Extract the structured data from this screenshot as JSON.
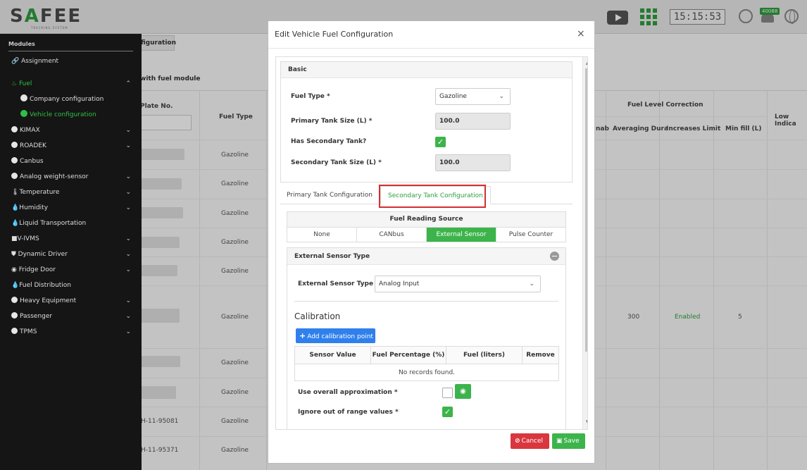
{
  "header": {
    "logo_text": "SAFEE",
    "logo_subtitle": "TRACKING SYSTEM",
    "clock": "15:15:53",
    "notification_count": "40088"
  },
  "sidebar": {
    "title": "Modules",
    "items": [
      {
        "label": "Assignment",
        "icon": "link-icon"
      },
      {
        "label": "Fuel",
        "icon": "fuel-icon",
        "chevron": "^"
      },
      {
        "label": "Company configuration"
      },
      {
        "label": "Vehicle configuration"
      },
      {
        "label": "KIMAX",
        "chevron": "v"
      },
      {
        "label": "ROADEK",
        "chevron": "v"
      },
      {
        "label": "Canbus"
      },
      {
        "label": "Analog weight-sensor",
        "chevron": "v"
      },
      {
        "label": "Temperature",
        "chevron": "v"
      },
      {
        "label": "Humidity",
        "chevron": "v"
      },
      {
        "label": "Liquid Transportation"
      },
      {
        "label": "V-IVMS",
        "chevron": "v"
      },
      {
        "label": "Dynamic Driver",
        "chevron": "v"
      },
      {
        "label": "Fridge Door",
        "chevron": "v"
      },
      {
        "label": "Fuel Distribution"
      },
      {
        "label": "Heavy Equipment",
        "chevron": "v"
      },
      {
        "label": "Passenger",
        "chevron": "v"
      },
      {
        "label": "TPMS",
        "chevron": "v"
      }
    ]
  },
  "background": {
    "tab_label": "figuration",
    "caption": "with fuel module",
    "columns": {
      "plate": "Plate No.",
      "fuel_type": "Fuel Type",
      "fuel_level_correction": "Fuel Level Correction",
      "enab": "nab",
      "averaging": "Averaging Dura",
      "increases": "Increases Limit",
      "min_fill": "Min fill (L)",
      "low_indicator": "Low Indica"
    },
    "rows": [
      {
        "plate": "",
        "fuel_type": "Gazoline"
      },
      {
        "plate": "",
        "fuel_type": "Gazoline"
      },
      {
        "plate": "",
        "fuel_type": "Gazoline"
      },
      {
        "plate": "",
        "fuel_type": "Gazoline"
      },
      {
        "plate": "",
        "fuel_type": "Gazoline"
      },
      {
        "plate": "",
        "fuel_type": "Gazoline",
        "averaging": "300",
        "increases": "Enabled",
        "min_fill": "5"
      },
      {
        "plate": "",
        "fuel_type": "Gazoline"
      },
      {
        "plate": "",
        "fuel_type": "Gazoline"
      },
      {
        "plate": "H-11-95081",
        "fuel_type": "Gazoline"
      },
      {
        "plate": "H-11-95371",
        "fuel_type": "Gazoline"
      }
    ]
  },
  "modal": {
    "title": "Edit Vehicle Fuel Configuration",
    "close": "×",
    "basic": {
      "heading": "Basic",
      "fuel_type_label": "Fuel Type  *",
      "fuel_type_value": "Gazoline",
      "primary_size_label": "Primary Tank Size (L)  *",
      "primary_size_value": "100.0",
      "has_secondary_label": "Has Secondary Tank?",
      "has_secondary_checked": true,
      "secondary_size_label": "Secondary Tank Size (L)  *",
      "secondary_size_value": "100.0"
    },
    "tabs": {
      "primary": "Primary Tank Configuration",
      "secondary": "Secondary Tank Configuration"
    },
    "fuel_reading_source": {
      "title": "Fuel Reading Source",
      "options": [
        "None",
        "CANbus",
        "External Sensor",
        "Pulse Counter"
      ],
      "selected": "External Sensor"
    },
    "external_sensor": {
      "heading": "External Sensor Type",
      "type_label": "External Sensor Type  *",
      "type_value": "Analog Input"
    },
    "calibration": {
      "title": "Calibration",
      "add_button": "Add calibration point",
      "columns": [
        "Sensor Value",
        "Fuel Percentage (%)",
        "Fuel (liters)",
        "Remove"
      ],
      "empty_text": "No records found."
    },
    "use_overall_label": "Use overall approximation  *",
    "ignore_range_label": "Ignore out of range values  *",
    "cancel_label": "Cancel",
    "save_label": "Save"
  }
}
